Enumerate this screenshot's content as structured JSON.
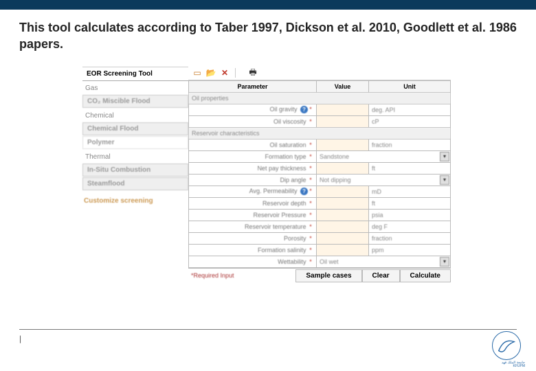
{
  "title": "This tool calculates according to Taber 1997, Dickson et al. 2010, Goodlett et al. 1986 papers.",
  "sidebar": {
    "header": "EOR Screening Tool",
    "groups": [
      {
        "label": "Gas",
        "items": [
          "CO₂ Miscible Flood"
        ]
      },
      {
        "label": "Chemical",
        "items": [
          "Chemical Flood",
          "Polymer"
        ]
      },
      {
        "label": "Thermal",
        "items": [
          "In-Situ Combustion",
          "Steamflood"
        ]
      }
    ],
    "customize": "Customize screening"
  },
  "toolbar": {
    "new_icon": "▢",
    "open_icon": "📂",
    "delete_icon": "✕",
    "print_icon": "🖶"
  },
  "columns": {
    "param": "Parameter",
    "value": "Value",
    "unit": "Unit"
  },
  "sections": [
    {
      "title": "Oil properties",
      "rows": [
        {
          "label": "Oil gravity",
          "help": true,
          "req": true,
          "unit": "deg. API"
        },
        {
          "label": "Oil viscosity",
          "req": true,
          "unit": "cP"
        }
      ]
    },
    {
      "title": "Reservoir characteristics",
      "rows": [
        {
          "label": "Oil saturation",
          "req": true,
          "unit": "fraction"
        },
        {
          "label": "Formation type",
          "req": true,
          "dropdown": "Sandstone"
        },
        {
          "label": "Net pay thickness",
          "req": true,
          "unit": "ft"
        },
        {
          "label": "Dip angle",
          "req": true,
          "dropdown": "Not dipping"
        },
        {
          "label": "Avg. Permeability",
          "help": true,
          "req": true,
          "unit": "mD"
        },
        {
          "label": "Reservoir depth",
          "req": true,
          "unit": "ft"
        },
        {
          "label": "Reservoir Pressure",
          "req": true,
          "unit": "psia"
        },
        {
          "label": "Reservoir temperature",
          "req": true,
          "unit": "deg F"
        },
        {
          "label": "Porosity",
          "req": true,
          "unit": "fraction"
        },
        {
          "label": "Formation salinity",
          "req": true,
          "unit": "ppm"
        },
        {
          "label": "Wettability",
          "req": true,
          "dropdown": "Oil wet"
        }
      ]
    }
  ],
  "required_note": "*Required Input",
  "actions": {
    "sample": "Sample cases",
    "clear": "Clear",
    "calc": "Calculate"
  },
  "page_mark": "|"
}
